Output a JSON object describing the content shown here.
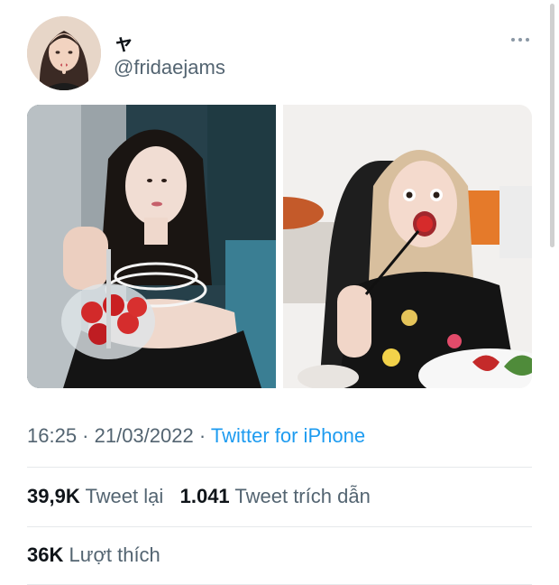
{
  "tweet": {
    "author": {
      "display_name": "ャ",
      "handle": "@fridaejams",
      "avatar_icon": "avatar-photo"
    },
    "media": [
      {
        "name": "photo-1",
        "icon": "photo-thumbnail"
      },
      {
        "name": "photo-2",
        "icon": "photo-thumbnail"
      }
    ],
    "timestamp": "16:25 · 21/03/2022 · ",
    "source": "Twitter for iPhone",
    "stats": {
      "retweets_count": "39,9K",
      "retweets_label": "Tweet lại",
      "quotes_count": "1.041",
      "quotes_label": "Tweet trích dẫn",
      "likes_count": "36K",
      "likes_label": "Lượt thích"
    },
    "colors": {
      "link": "#1d9bf0",
      "secondary_text": "#536471",
      "primary_text": "#0f1419",
      "divider": "#e6e9eb"
    }
  }
}
